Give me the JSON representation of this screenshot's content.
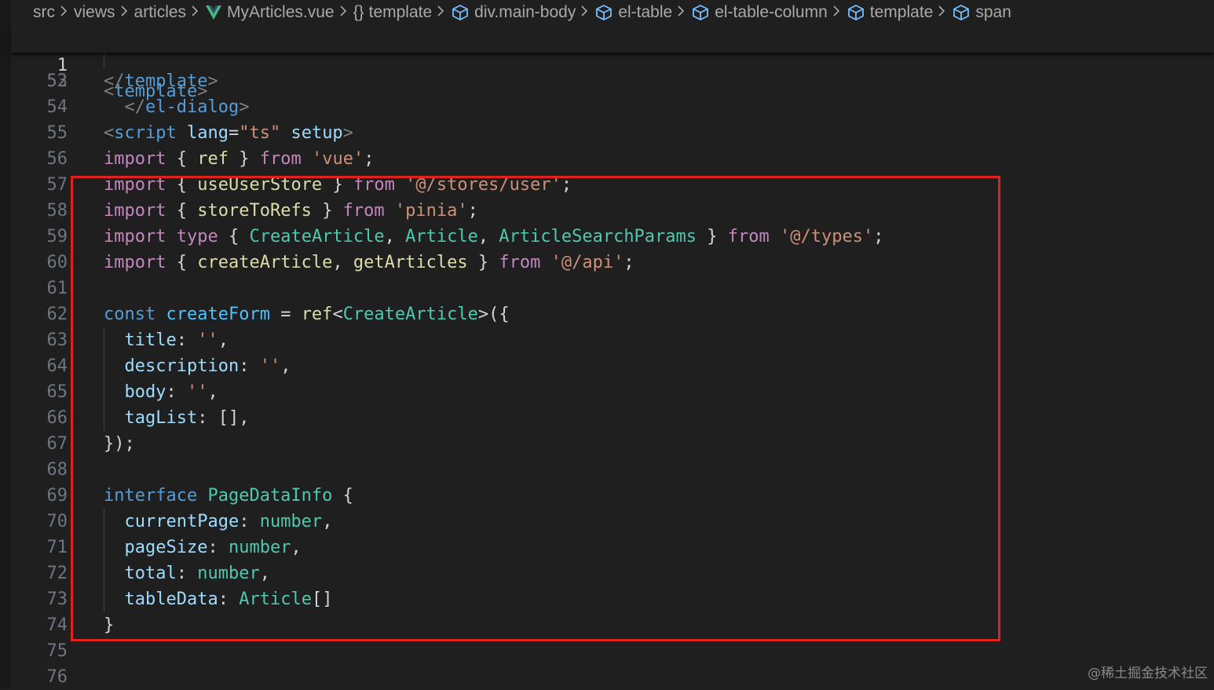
{
  "breadcrumb": {
    "items": [
      {
        "label": "src",
        "icon": null
      },
      {
        "label": "views",
        "icon": null
      },
      {
        "label": "articles",
        "icon": null
      },
      {
        "label": "MyArticles.vue",
        "icon": "vue-icon"
      },
      {
        "label": "template",
        "icon": "braces-icon"
      },
      {
        "label": "div.main-body",
        "icon": "cube-icon"
      },
      {
        "label": "el-table",
        "icon": "cube-icon"
      },
      {
        "label": "el-table-column",
        "icon": "cube-icon"
      },
      {
        "label": "template",
        "icon": "cube-icon"
      },
      {
        "label": "span",
        "icon": "cube-icon"
      }
    ]
  },
  "sticky": {
    "line_number": "1",
    "text": "<template>"
  },
  "partial_line": {
    "line_number": "52",
    "text": "  </el-dialog>"
  },
  "lines": [
    {
      "n": "53",
      "text": "</template>"
    },
    {
      "n": "54",
      "text": ""
    },
    {
      "n": "55",
      "text": "<script lang=\"ts\" setup>"
    },
    {
      "n": "56",
      "text": "import { ref } from 'vue';"
    },
    {
      "n": "57",
      "text": "import { useUserStore } from '@/stores/user';"
    },
    {
      "n": "58",
      "text": "import { storeToRefs } from 'pinia';"
    },
    {
      "n": "59",
      "text": "import type { CreateArticle, Article, ArticleSearchParams } from '@/types';"
    },
    {
      "n": "60",
      "text": "import { createArticle, getArticles } from '@/api';"
    },
    {
      "n": "61",
      "text": ""
    },
    {
      "n": "62",
      "text": "const createForm = ref<CreateArticle>({"
    },
    {
      "n": "63",
      "text": "  title: '',"
    },
    {
      "n": "64",
      "text": "  description: '',"
    },
    {
      "n": "65",
      "text": "  body: '',"
    },
    {
      "n": "66",
      "text": "  tagList: [],"
    },
    {
      "n": "67",
      "text": "});"
    },
    {
      "n": "68",
      "text": ""
    },
    {
      "n": "69",
      "text": "interface PageDataInfo {"
    },
    {
      "n": "70",
      "text": "  currentPage: number,"
    },
    {
      "n": "71",
      "text": "  pageSize: number,"
    },
    {
      "n": "72",
      "text": "  total: number,"
    },
    {
      "n": "73",
      "text": "  tableData: Article[]"
    },
    {
      "n": "74",
      "text": "}"
    },
    {
      "n": "75",
      "text": ""
    },
    {
      "n": "76",
      "text": ""
    }
  ],
  "highlight_color": "#e0211d",
  "watermark": "@稀土掘金技术社区"
}
